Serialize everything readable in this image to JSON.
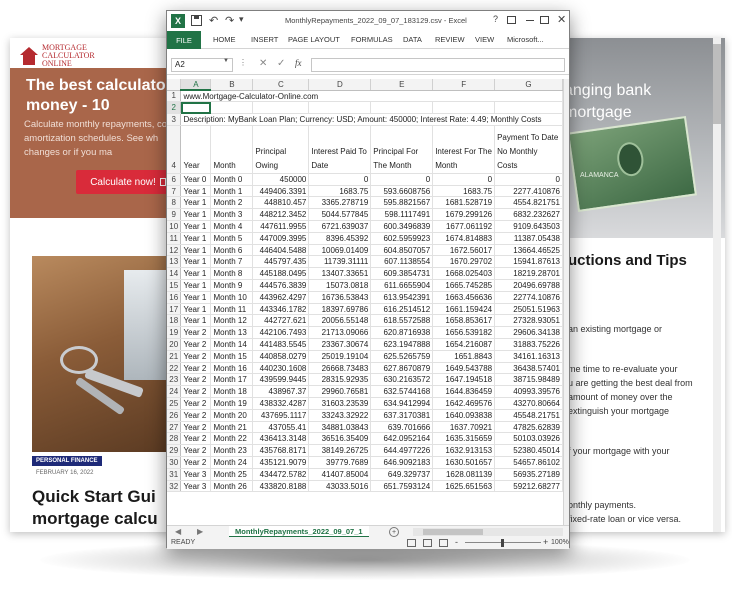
{
  "left_page": {
    "logo": [
      "MORTGAGE",
      "CALCULATOR",
      "ONLINE"
    ],
    "hero_title": "The best calculator money - 10",
    "hero_sub": "Calculate monthly repayments, co amortization schedules. See wh changes or if you ma",
    "cta": "Calculate now!",
    "badge": "PERSONAL FINANCE",
    "post_date": "FEBRUARY 16, 2022",
    "post_title": "Quick Start Gui mortgage calcu"
  },
  "right_page": {
    "hero_title": "anging bank mortgage",
    "hero_caption": "ALAMANCA",
    "section_title": "uctions and Tips",
    "p1": "an existing mortgage or",
    "p2": "me time to re-evaluate your",
    "p3": "u are getting the best deal from",
    "p4": "amount of money over the",
    "p5": "extinguish your mortgage",
    "p6": "f your mortgage with your",
    "p7": "onthly payments.",
    "p8": "fixed-rate loan or vice versa."
  },
  "excel": {
    "app_icon": "X",
    "window_title": "MonthlyRepayments_2022_09_07_183129.csv - Excel",
    "help": "?",
    "ribbon_tabs": [
      "FILE",
      "HOME",
      "INSERT",
      "PAGE LAYOUT",
      "FORMULAS",
      "DATA",
      "REVIEW",
      "VIEW",
      "Microsoft..."
    ],
    "name_box": "A2",
    "fx": "fx",
    "columns": [
      "A",
      "B",
      "C",
      "D",
      "E",
      "F",
      "G"
    ],
    "row1": "www.Mortgage-Calculator-Online.com",
    "row3": "Description: MyBank Loan Plan; Currency: USD; Amount: 450000; Interest Rate: 4.49; Monthly Costs",
    "headers": [
      "Year",
      "Month",
      "Principal Owing",
      "Interest Paid To Date",
      "Principal For The Month",
      "Interest For The Month",
      "Payment To Date No Monthly Costs"
    ],
    "rows": [
      [
        "Year 0",
        "Month 0",
        "450000",
        "0",
        "0",
        "0",
        "0"
      ],
      [
        "Year 1",
        "Month 1",
        "449406.3391",
        "1683.75",
        "593.6608756",
        "1683.75",
        "2277.410876"
      ],
      [
        "Year 1",
        "Month 2",
        "448810.457",
        "3365.278719",
        "595.8821567",
        "1681.528719",
        "4554.821751"
      ],
      [
        "Year 1",
        "Month 3",
        "448212.3452",
        "5044.577845",
        "598.1117491",
        "1679.299126",
        "6832.232627"
      ],
      [
        "Year 1",
        "Month 4",
        "447611.9955",
        "6721.639037",
        "600.3496839",
        "1677.061192",
        "9109.643503"
      ],
      [
        "Year 1",
        "Month 5",
        "447009.3995",
        "8396.45392",
        "602.5959923",
        "1674.814883",
        "11387.05438"
      ],
      [
        "Year 1",
        "Month 6",
        "446404.5488",
        "10069.01409",
        "604.8507057",
        "1672.56017",
        "13664.46525"
      ],
      [
        "Year 1",
        "Month 7",
        "445797.435",
        "11739.31111",
        "607.1138554",
        "1670.29702",
        "15941.87613"
      ],
      [
        "Year 1",
        "Month 8",
        "445188.0495",
        "13407.33651",
        "609.3854731",
        "1668.025403",
        "18219.28701"
      ],
      [
        "Year 1",
        "Month 9",
        "444576.3839",
        "15073.0818",
        "611.6655904",
        "1665.745285",
        "20496.69788"
      ],
      [
        "Year 1",
        "Month 10",
        "443962.4297",
        "16736.53843",
        "613.9542391",
        "1663.456636",
        "22774.10876"
      ],
      [
        "Year 1",
        "Month 11",
        "443346.1782",
        "18397.69786",
        "616.2514512",
        "1661.159424",
        "25051.51963"
      ],
      [
        "Year 1",
        "Month 12",
        "442727.621",
        "20056.55148",
        "618.5572588",
        "1658.853617",
        "27328.93051"
      ],
      [
        "Year 2",
        "Month 13",
        "442106.7493",
        "21713.09066",
        "620.8716938",
        "1656.539182",
        "29606.34138"
      ],
      [
        "Year 2",
        "Month 14",
        "441483.5545",
        "23367.30674",
        "623.1947888",
        "1654.216087",
        "31883.75226"
      ],
      [
        "Year 2",
        "Month 15",
        "440858.0279",
        "25019.19104",
        "625.5265759",
        "1651.8843",
        "34161.16313"
      ],
      [
        "Year 2",
        "Month 16",
        "440230.1608",
        "26668.73483",
        "627.8670879",
        "1649.543788",
        "36438.57401"
      ],
      [
        "Year 2",
        "Month 17",
        "439599.9445",
        "28315.92935",
        "630.2163572",
        "1647.194518",
        "38715.98489"
      ],
      [
        "Year 2",
        "Month 18",
        "438967.37",
        "29960.76581",
        "632.5744168",
        "1644.836459",
        "40993.39576"
      ],
      [
        "Year 2",
        "Month 19",
        "438332.4287",
        "31603.23539",
        "634.9412994",
        "1642.469576",
        "43270.80664"
      ],
      [
        "Year 2",
        "Month 20",
        "437695.1117",
        "33243.32922",
        "637.3170381",
        "1640.093838",
        "45548.21751"
      ],
      [
        "Year 2",
        "Month 21",
        "437055.41",
        "34881.03843",
        "639.701666",
        "1637.70921",
        "47825.62839"
      ],
      [
        "Year 2",
        "Month 22",
        "436413.3148",
        "36516.35409",
        "642.0952164",
        "1635.315659",
        "50103.03926"
      ],
      [
        "Year 2",
        "Month 23",
        "435768.8171",
        "38149.26725",
        "644.4977226",
        "1632.913153",
        "52380.45014"
      ],
      [
        "Year 2",
        "Month 24",
        "435121.9079",
        "39779.7689",
        "646.9092183",
        "1630.501657",
        "54657.86102"
      ],
      [
        "Year 3",
        "Month 25",
        "434472.5782",
        "41407.85004",
        "649.329737",
        "1628.081139",
        "56935.27189"
      ],
      [
        "Year 3",
        "Month 26",
        "433820.8188",
        "43033.5016",
        "651.7593124",
        "1625.651563",
        "59212.68277"
      ]
    ],
    "row_numbers": [
      "1",
      "2",
      "3",
      "4",
      "5",
      "6",
      "7",
      "8",
      "9",
      "10",
      "11",
      "12",
      "13",
      "14",
      "15",
      "16",
      "17",
      "18",
      "19",
      "20",
      "21",
      "22",
      "23",
      "24",
      "25",
      "26",
      "27",
      "28",
      "29",
      "30",
      "31",
      "32",
      "33"
    ],
    "sheet_tab": "MonthlyRepayments_2022_09_07_1",
    "nav_prev": "◀",
    "nav_next": "▶",
    "sheet_add": "+",
    "status": "READY",
    "zoom_minus": "-",
    "zoom_plus": "+",
    "zoom": "100%"
  }
}
